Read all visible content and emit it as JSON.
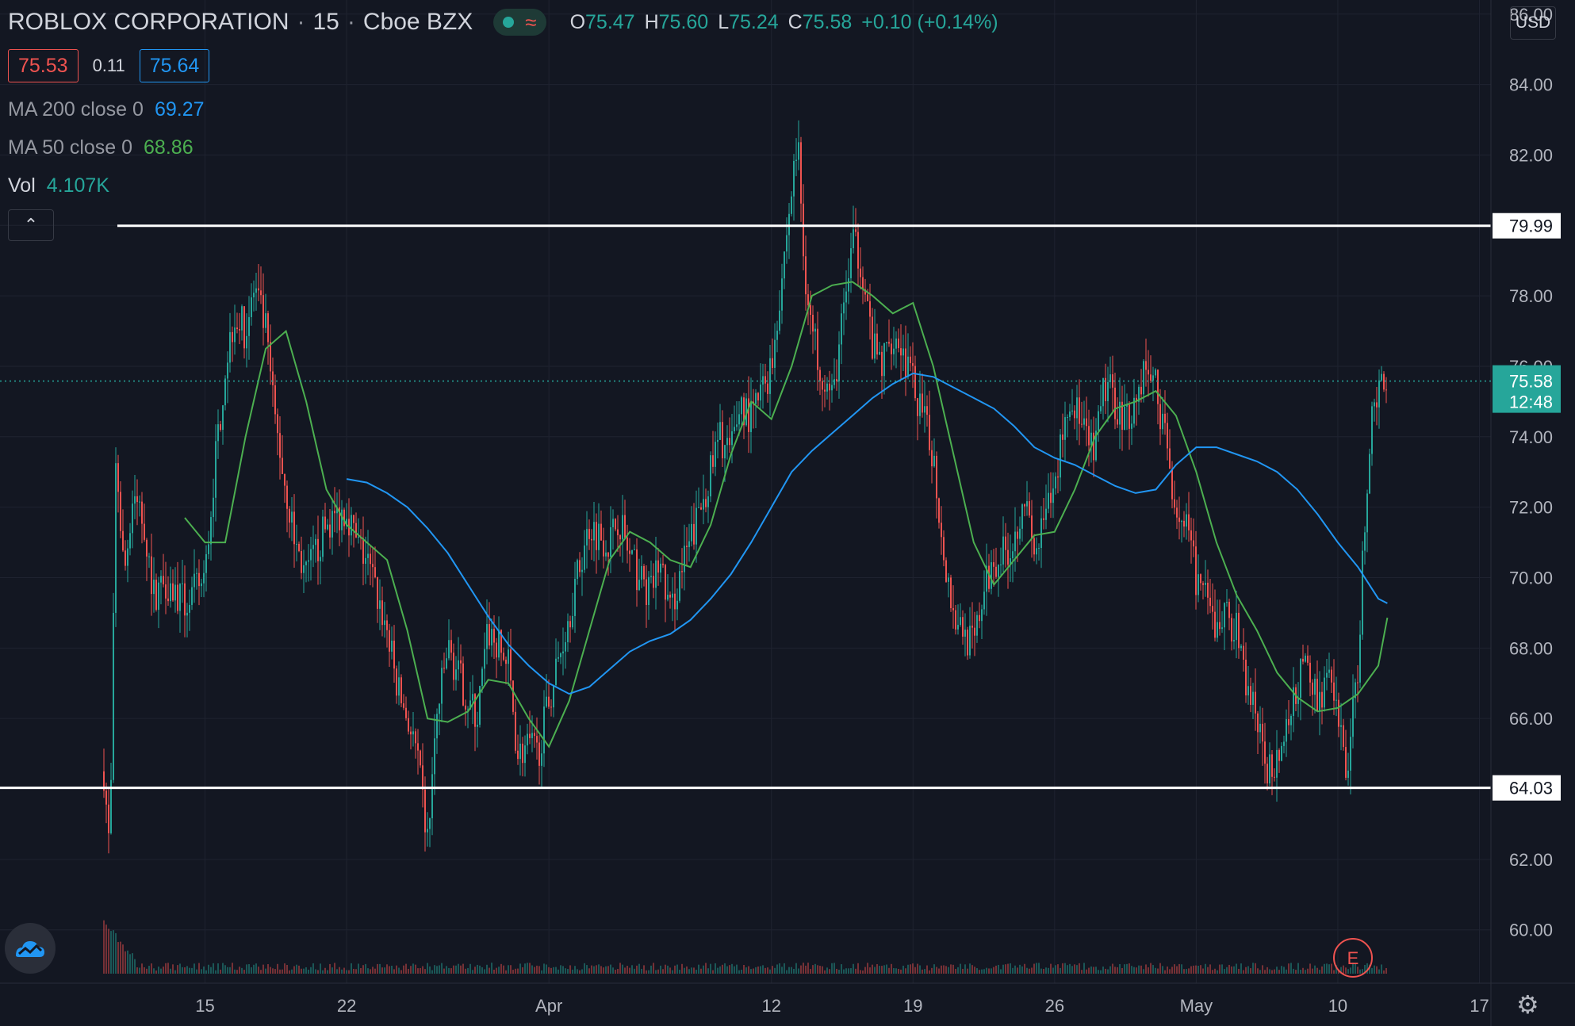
{
  "header": {
    "symbol": "ROBLOX CORPORATION",
    "interval": "15",
    "exchange": "Cboe BZX",
    "ohlc": {
      "o_label": "O",
      "o": "75.47",
      "h_label": "H",
      "h": "75.60",
      "l_label": "L",
      "l": "75.24",
      "c_label": "C",
      "c": "75.58",
      "change": "+0.10 (+0.14%)"
    },
    "bid": "75.53",
    "spread": "0.11",
    "ask": "75.64"
  },
  "indicators": {
    "ma200": {
      "label": "MA 200 close 0",
      "value": "69.27"
    },
    "ma50": {
      "label": "MA 50 close 0",
      "value": "68.86"
    },
    "vol": {
      "label": "Vol",
      "value": "4.107K"
    }
  },
  "currency": "USD",
  "controls": {
    "collapse": "⌃",
    "earnings_marker": "E",
    "settings": "⚙"
  },
  "colors": {
    "up": "#26a69a",
    "down": "#ef5350",
    "ma200": "#2196f3",
    "ma50": "#4caf50",
    "level_line": "#ffffff",
    "background": "#131722"
  },
  "chart_data": {
    "type": "candlestick",
    "y_axis": {
      "min": 58.8,
      "max": 86.4,
      "ticks": [
        "60.00",
        "62.00",
        "64.00",
        "66.00",
        "68.00",
        "70.00",
        "72.00",
        "74.00",
        "76.00",
        "78.00",
        "80.00",
        "82.00",
        "84.00",
        "86.00"
      ]
    },
    "x_axis": {
      "start": "2021-03-10",
      "end": "2021-05-18",
      "ticks": [
        {
          "date": "2021-03-15",
          "label": "15"
        },
        {
          "date": "2021-03-22",
          "label": "22"
        },
        {
          "date": "2021-04-01",
          "label": "Apr"
        },
        {
          "date": "2021-04-12",
          "label": "12"
        },
        {
          "date": "2021-04-19",
          "label": "19"
        },
        {
          "date": "2021-04-26",
          "label": "26"
        },
        {
          "date": "2021-05-03",
          "label": "May"
        },
        {
          "date": "2021-05-10",
          "label": "10"
        },
        {
          "date": "2021-05-17",
          "label": "17"
        }
      ]
    },
    "levels": [
      {
        "value": 79.99,
        "label": "79.99"
      },
      {
        "value": 64.03,
        "label": "64.03"
      }
    ],
    "last_price": {
      "value": 75.58,
      "label": "75.58",
      "countdown": "12:48"
    },
    "price_path": [
      [
        "2021-03-10",
        64.5
      ],
      [
        "2021-03-10",
        62.0
      ],
      [
        "2021-03-10",
        73.5
      ],
      [
        "2021-03-11",
        70.0
      ],
      [
        "2021-03-11",
        72.5
      ],
      [
        "2021-03-12",
        71.5
      ],
      [
        "2021-03-12",
        69.5
      ],
      [
        "2021-03-13",
        70.0
      ],
      [
        "2021-03-14",
        69.2
      ],
      [
        "2021-03-15",
        70.0
      ],
      [
        "2021-03-15",
        73.0
      ],
      [
        "2021-03-16",
        76.0
      ],
      [
        "2021-03-16",
        77.5
      ],
      [
        "2021-03-17",
        77.0
      ],
      [
        "2021-03-17",
        78.2
      ],
      [
        "2021-03-18",
        77.0
      ],
      [
        "2021-03-18",
        74.5
      ],
      [
        "2021-03-19",
        72.5
      ],
      [
        "2021-03-19",
        71.0
      ],
      [
        "2021-03-20",
        70.0
      ],
      [
        "2021-03-21",
        71.5
      ],
      [
        "2021-03-22",
        72.0
      ],
      [
        "2021-03-22",
        71.0
      ],
      [
        "2021-03-23",
        70.5
      ],
      [
        "2021-03-24",
        68.5
      ],
      [
        "2021-03-24",
        67.0
      ],
      [
        "2021-03-25",
        66.0
      ],
      [
        "2021-03-25",
        65.0
      ],
      [
        "2021-03-26",
        62.5
      ],
      [
        "2021-03-26",
        66.0
      ],
      [
        "2021-03-27",
        68.0
      ],
      [
        "2021-03-28",
        66.5
      ],
      [
        "2021-03-28",
        66.0
      ],
      [
        "2021-03-29",
        68.5
      ],
      [
        "2021-03-30",
        67.5
      ],
      [
        "2021-03-30",
        65.0
      ],
      [
        "2021-03-31",
        65.2
      ],
      [
        "2021-03-31",
        65.0
      ],
      [
        "2021-04-01",
        66.5
      ],
      [
        "2021-04-02",
        69.0
      ],
      [
        "2021-04-03",
        71.5
      ],
      [
        "2021-04-04",
        71.0
      ],
      [
        "2021-04-04",
        71.8
      ],
      [
        "2021-04-05",
        70.5
      ],
      [
        "2021-04-06",
        69.5
      ],
      [
        "2021-04-06",
        70.5
      ],
      [
        "2021-04-07",
        69.0
      ],
      [
        "2021-04-07",
        70.0
      ],
      [
        "2021-04-08",
        71.0
      ],
      [
        "2021-04-09",
        73.0
      ],
      [
        "2021-04-09",
        74.0
      ],
      [
        "2021-04-10",
        73.5
      ],
      [
        "2021-04-10",
        75.0
      ],
      [
        "2021-04-11",
        74.5
      ],
      [
        "2021-04-11",
        75.2
      ],
      [
        "2021-04-12",
        76.0
      ],
      [
        "2021-04-13",
        81.0
      ],
      [
        "2021-04-13",
        82.5
      ],
      [
        "2021-04-13",
        79.0
      ],
      [
        "2021-04-14",
        77.0
      ],
      [
        "2021-04-14",
        76.0
      ],
      [
        "2021-04-15",
        75.0
      ],
      [
        "2021-04-16",
        79.5
      ],
      [
        "2021-04-16",
        79.0
      ],
      [
        "2021-04-17",
        76.5
      ],
      [
        "2021-04-17",
        76.0
      ],
      [
        "2021-04-18",
        77.0
      ],
      [
        "2021-04-18",
        76.5
      ],
      [
        "2021-04-19",
        75.5
      ],
      [
        "2021-04-20",
        73.5
      ],
      [
        "2021-04-20",
        71.0
      ],
      [
        "2021-04-21",
        69.0
      ],
      [
        "2021-04-22",
        68.0
      ],
      [
        "2021-04-22",
        69.5
      ],
      [
        "2021-04-23",
        70.5
      ],
      [
        "2021-04-24",
        71.0
      ],
      [
        "2021-04-24",
        72.5
      ],
      [
        "2021-04-25",
        70.5
      ],
      [
        "2021-04-25",
        71.5
      ],
      [
        "2021-04-26",
        72.5
      ],
      [
        "2021-04-26",
        74.5
      ],
      [
        "2021-04-27",
        75.0
      ],
      [
        "2021-04-27",
        74.0
      ],
      [
        "2021-04-28",
        73.5
      ],
      [
        "2021-04-28",
        75.5
      ],
      [
        "2021-04-29",
        75.0
      ],
      [
        "2021-04-29",
        74.5
      ],
      [
        "2021-04-30",
        75.0
      ],
      [
        "2021-04-30",
        76.0
      ],
      [
        "2021-05-01",
        75.5
      ],
      [
        "2021-05-01",
        74.0
      ],
      [
        "2021-05-02",
        72.0
      ],
      [
        "2021-05-02",
        71.5
      ],
      [
        "2021-05-03",
        70.0
      ],
      [
        "2021-05-04",
        68.5
      ],
      [
        "2021-05-04",
        69.0
      ],
      [
        "2021-05-05",
        68.5
      ],
      [
        "2021-05-05",
        67.0
      ],
      [
        "2021-05-06",
        66.0
      ],
      [
        "2021-05-06",
        64.4
      ],
      [
        "2021-05-07",
        65.0
      ],
      [
        "2021-05-07",
        65.5
      ],
      [
        "2021-05-08",
        67.0
      ],
      [
        "2021-05-08",
        67.5
      ],
      [
        "2021-05-09",
        66.5
      ],
      [
        "2021-05-09",
        67.2
      ],
      [
        "2021-05-10",
        66.0
      ],
      [
        "2021-05-10",
        64.5
      ],
      [
        "2021-05-11",
        67.5
      ],
      [
        "2021-05-11",
        71.5
      ],
      [
        "2021-05-11",
        74.0
      ],
      [
        "2021-05-12",
        75.5
      ],
      [
        "2021-05-12",
        75.58
      ]
    ],
    "series": [
      {
        "name": "MA 50 close 0",
        "points": [
          [
            "2021-03-14",
            71.7
          ],
          [
            "2021-03-15",
            71.0
          ],
          [
            "2021-03-16",
            71.0
          ],
          [
            "2021-03-17",
            74.0
          ],
          [
            "2021-03-18",
            76.5
          ],
          [
            "2021-03-19",
            77.0
          ],
          [
            "2021-03-20",
            75.0
          ],
          [
            "2021-03-21",
            72.5
          ],
          [
            "2021-03-22",
            71.5
          ],
          [
            "2021-03-23",
            71.0
          ],
          [
            "2021-03-24",
            70.5
          ],
          [
            "2021-03-25",
            68.5
          ],
          [
            "2021-03-26",
            66.0
          ],
          [
            "2021-03-27",
            65.9
          ],
          [
            "2021-03-28",
            66.2
          ],
          [
            "2021-03-29",
            67.1
          ],
          [
            "2021-03-30",
            67.0
          ],
          [
            "2021-03-31",
            66.0
          ],
          [
            "2021-04-01",
            65.2
          ],
          [
            "2021-04-02",
            66.5
          ],
          [
            "2021-04-03",
            68.5
          ],
          [
            "2021-04-04",
            70.5
          ],
          [
            "2021-04-05",
            71.3
          ],
          [
            "2021-04-06",
            71.0
          ],
          [
            "2021-04-07",
            70.5
          ],
          [
            "2021-04-08",
            70.3
          ],
          [
            "2021-04-09",
            71.5
          ],
          [
            "2021-04-10",
            73.5
          ],
          [
            "2021-04-11",
            75.0
          ],
          [
            "2021-04-12",
            74.5
          ],
          [
            "2021-04-13",
            76.0
          ],
          [
            "2021-04-14",
            78.0
          ],
          [
            "2021-04-15",
            78.3
          ],
          [
            "2021-04-16",
            78.4
          ],
          [
            "2021-04-17",
            78.0
          ],
          [
            "2021-04-18",
            77.5
          ],
          [
            "2021-04-19",
            77.8
          ],
          [
            "2021-04-20",
            76.0
          ],
          [
            "2021-04-21",
            73.5
          ],
          [
            "2021-04-22",
            71.0
          ],
          [
            "2021-04-23",
            69.8
          ],
          [
            "2021-04-24",
            70.5
          ],
          [
            "2021-04-25",
            71.2
          ],
          [
            "2021-04-26",
            71.3
          ],
          [
            "2021-04-27",
            72.5
          ],
          [
            "2021-04-28",
            74.0
          ],
          [
            "2021-04-29",
            74.8
          ],
          [
            "2021-04-30",
            75.0
          ],
          [
            "2021-05-01",
            75.3
          ],
          [
            "2021-05-02",
            74.6
          ],
          [
            "2021-05-03",
            73.0
          ],
          [
            "2021-05-04",
            71.0
          ],
          [
            "2021-05-05",
            69.5
          ],
          [
            "2021-05-06",
            68.5
          ],
          [
            "2021-05-07",
            67.3
          ],
          [
            "2021-05-08",
            66.6
          ],
          [
            "2021-05-09",
            66.2
          ],
          [
            "2021-05-10",
            66.3
          ],
          [
            "2021-05-11",
            66.7
          ],
          [
            "2021-05-12",
            67.5
          ],
          [
            "2021-05-12",
            68.86
          ]
        ]
      },
      {
        "name": "MA 200 close 0",
        "points": [
          [
            "2021-03-22",
            72.8
          ],
          [
            "2021-03-23",
            72.7
          ],
          [
            "2021-03-24",
            72.4
          ],
          [
            "2021-03-25",
            72.0
          ],
          [
            "2021-03-26",
            71.4
          ],
          [
            "2021-03-27",
            70.7
          ],
          [
            "2021-03-28",
            69.8
          ],
          [
            "2021-03-29",
            68.9
          ],
          [
            "2021-03-30",
            68.1
          ],
          [
            "2021-03-31",
            67.5
          ],
          [
            "2021-04-01",
            67.0
          ],
          [
            "2021-04-02",
            66.7
          ],
          [
            "2021-04-03",
            66.9
          ],
          [
            "2021-04-04",
            67.4
          ],
          [
            "2021-04-05",
            67.9
          ],
          [
            "2021-04-06",
            68.2
          ],
          [
            "2021-04-07",
            68.4
          ],
          [
            "2021-04-08",
            68.8
          ],
          [
            "2021-04-09",
            69.4
          ],
          [
            "2021-04-10",
            70.1
          ],
          [
            "2021-04-11",
            71.0
          ],
          [
            "2021-04-12",
            72.0
          ],
          [
            "2021-04-13",
            73.0
          ],
          [
            "2021-04-14",
            73.6
          ],
          [
            "2021-04-15",
            74.1
          ],
          [
            "2021-04-16",
            74.6
          ],
          [
            "2021-04-17",
            75.1
          ],
          [
            "2021-04-18",
            75.5
          ],
          [
            "2021-04-19",
            75.8
          ],
          [
            "2021-04-20",
            75.7
          ],
          [
            "2021-04-21",
            75.4
          ],
          [
            "2021-04-22",
            75.1
          ],
          [
            "2021-04-23",
            74.8
          ],
          [
            "2021-04-24",
            74.3
          ],
          [
            "2021-04-25",
            73.7
          ],
          [
            "2021-04-26",
            73.4
          ],
          [
            "2021-04-27",
            73.2
          ],
          [
            "2021-04-28",
            72.9
          ],
          [
            "2021-04-29",
            72.6
          ],
          [
            "2021-04-30",
            72.4
          ],
          [
            "2021-05-01",
            72.5
          ],
          [
            "2021-05-02",
            73.2
          ],
          [
            "2021-05-03",
            73.7
          ],
          [
            "2021-05-04",
            73.7
          ],
          [
            "2021-05-05",
            73.5
          ],
          [
            "2021-05-06",
            73.3
          ],
          [
            "2021-05-07",
            73.0
          ],
          [
            "2021-05-08",
            72.5
          ],
          [
            "2021-05-09",
            71.8
          ],
          [
            "2021-05-10",
            71.0
          ],
          [
            "2021-05-11",
            70.3
          ],
          [
            "2021-05-12",
            69.4
          ],
          [
            "2021-05-12",
            69.27
          ]
        ]
      }
    ]
  }
}
